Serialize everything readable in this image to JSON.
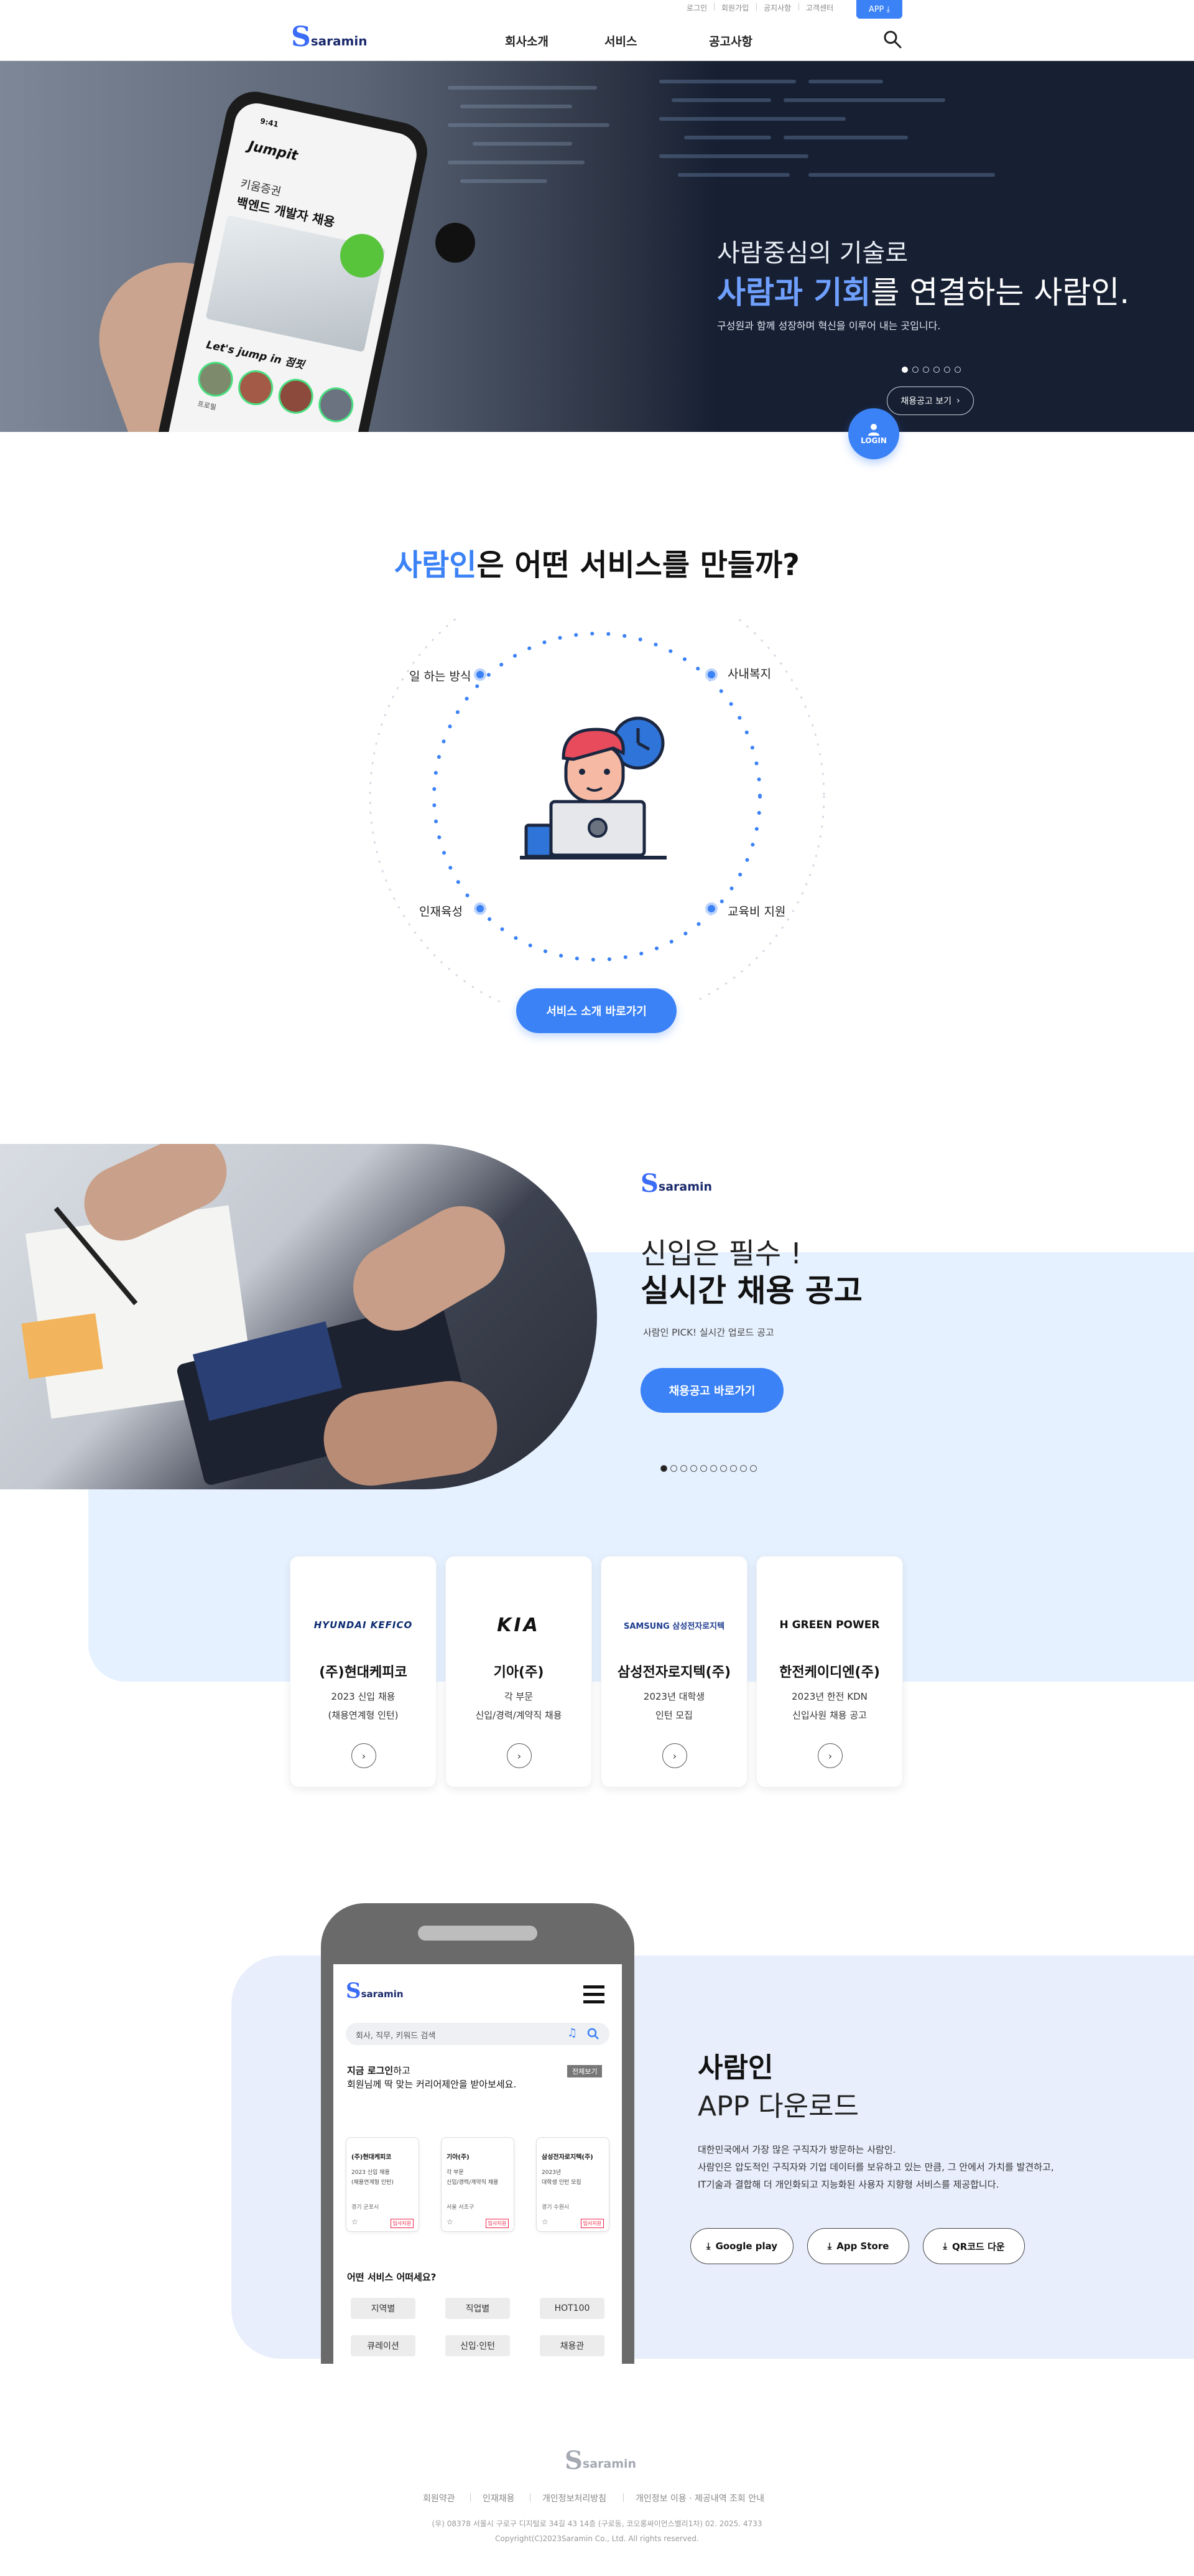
{
  "brand": {
    "logo_s": "S",
    "logo_text": "saramin",
    "accent_color": "#3b82f6"
  },
  "header": {
    "util_links": [
      "로그인",
      "회원가입",
      "공지사항",
      "고객센터"
    ],
    "app_label": "APP",
    "nav": [
      "회사소개",
      "서비스",
      "공고사항"
    ]
  },
  "hero": {
    "title_line1": "사람중심의 기술로",
    "title_accent": "사람과 기회",
    "title_rest": "를 연결하는 사람인.",
    "subtitle": "구성원과 함께 성장하며 혁신을 이루어 내는 곳입니다.",
    "button_label": "채용공고 보기",
    "slides": 6,
    "active_slide": 1,
    "login_label": "LOGIN",
    "phone": {
      "time": "9:41",
      "app_name": "Jumpit",
      "company": "키움증권",
      "job": "백엔드 개발자 채용",
      "tagline": "Let's jump in 점핏",
      "profile_caption": "프로필"
    }
  },
  "services": {
    "title_accent": "사람인",
    "title_rest": "은 어떤 서비스를 만들까?",
    "labels": [
      "일 하는 방식",
      "사내복지",
      "인재육성",
      "교육비 지원"
    ],
    "button_label": "서비스 소개 바로가기"
  },
  "recruit": {
    "title_line1": "신입은 필수 !",
    "title_line2": "실시간 채용 공고",
    "subtitle": "사람인 PICK! 실시간 업로드 공고",
    "button_label": "채용공고 바로가기",
    "slides": 10,
    "active_slide": 1,
    "cards": [
      {
        "logo": "HYUNDAI KEFICO",
        "name": "(주)현대케피코",
        "line1": "2023 신입 채용",
        "line2": "(채용연계형 인턴)"
      },
      {
        "logo": "KIA",
        "name": "기아(주)",
        "line1": "각 부문",
        "line2": "신입/경력/계약직 채용"
      },
      {
        "logo": "SAMSUNG 삼성전자로지텍",
        "name": "삼성전자로지텍(주)",
        "line1": "2023년 대학생",
        "line2": "인턴 모집"
      },
      {
        "logo": "H GREEN POWER",
        "name": "한전케이디엔(주)",
        "line1": "2023년 한전 KDN",
        "line2": "신입사원 채용 공고"
      }
    ]
  },
  "app": {
    "title_line1": "사람인",
    "title_line2": "APP 다운로드",
    "desc_line1": "대한민국에서 가장 많은 구직자가 방문하는 사람인.",
    "desc_line2": "사람인은 압도적인 구직자와 기업 데이터를 보유하고 있는 만큼, 그 안에서 가치를 발견하고,",
    "desc_line3": "IT기술과 결합해 더 개인화되고 지능화된 사용자 지향형 서비스를 제공합니다.",
    "buttons": [
      "Google play",
      "App Store",
      "QR코드 다운"
    ],
    "mock": {
      "search_placeholder": "회사, 직무, 키워드 검색",
      "login_prompt_bold": "지금 로그인",
      "login_prompt_rest": "하고",
      "login_prompt_line2": "회원님께 딱 맞는 커리어제안을 받아보세요.",
      "view_all": "전체보기",
      "cards": [
        {
          "name": "(주)현대케피코",
          "line1": "2023 신입 채용",
          "line2": "(채용연계형 인턴)",
          "loc": "경기 군포시",
          "tag": "입사지원"
        },
        {
          "name": "기아(주)",
          "line1": "각 부문",
          "line2": "신입/경력/계약직 채용",
          "loc": "서울 서초구",
          "tag": "입사지원"
        },
        {
          "name": "삼성전자로지텍(주)",
          "line1": "2023년",
          "line2": "대학생 인턴 모집",
          "loc": "경기 수원시",
          "tag": "입사지원"
        }
      ],
      "question": "어떤 서비스 어떠세요?",
      "chips": [
        "지역별",
        "직업별",
        "HOT100",
        "큐레이션",
        "신입·인턴",
        "채용관"
      ]
    }
  },
  "footer": {
    "links": [
      "회원약관",
      "인재채용",
      "개인정보처리방침",
      "개인정보 이용 · 제공내역 조회 안내"
    ],
    "address": "(우) 08378 서울시 구로구 디지털로 34길 43 14층 (구로동, 코오롱싸이언스밸리1차) 02. 2025. 4733",
    "copyright": "Copyright(C)2023Saramin Co., Ltd. All rights reserved."
  }
}
